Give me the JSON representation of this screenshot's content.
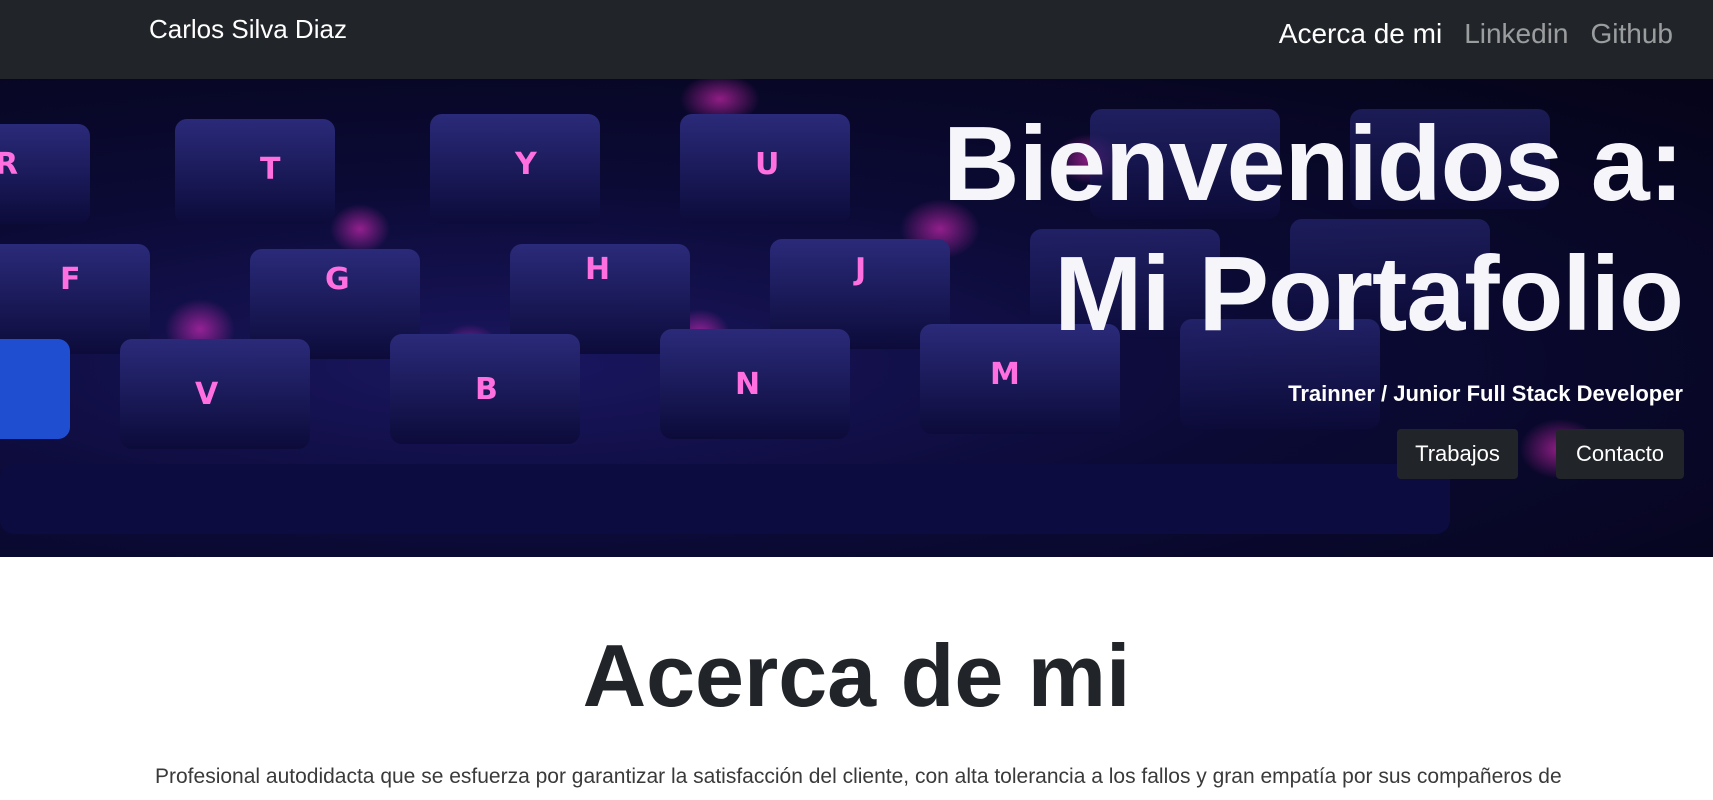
{
  "navbar": {
    "brand": "Carlos Silva Diaz",
    "links": [
      {
        "label": "Acerca de mi",
        "active": true
      },
      {
        "label": "Linkedin",
        "active": false
      },
      {
        "label": "Github",
        "active": false
      }
    ]
  },
  "hero": {
    "title_line1": "Bienvenidos a:",
    "title_line2": "Mi Portafolio",
    "subtitle": "Trainner / Junior Full Stack Developer",
    "buttons": {
      "trabajos": "Trabajos",
      "contacto": "Contacto"
    }
  },
  "about": {
    "title": "Acerca de mi",
    "text": "Profesional autodidacta que se esfuerza por garantizar la satisfacción del cliente, con alta tolerancia a los fallos y gran empatía por sus compañeros de"
  },
  "colors": {
    "navbar_bg": "#212529",
    "button_bg": "#212529",
    "hero_bg": "#0b0a35",
    "key_legend": "#ff4fd8"
  }
}
